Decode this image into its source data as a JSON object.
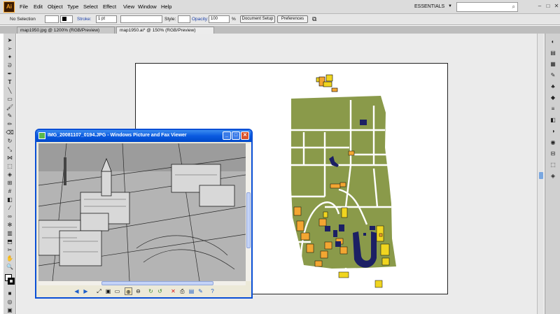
{
  "app": {
    "logo": "Ai"
  },
  "menu": [
    "File",
    "Edit",
    "Object",
    "Type",
    "Select",
    "Effect",
    "View",
    "Window",
    "Help"
  ],
  "workspace": {
    "label": "ESSENTIALS"
  },
  "controlbar": {
    "selection": "No Selection",
    "stroke_label": "Stroke:",
    "stroke_value": "1 pt",
    "style_label": "Style:",
    "opacity_label": "Opacity:",
    "opacity_value": "100",
    "percent": "%",
    "doc_setup": "Document Setup",
    "preferences": "Preferences"
  },
  "tabs": [
    {
      "label": "map1950.jpg @ 1200% (RGB/Preview)"
    },
    {
      "label": "map1950.ai* @ 150% (RGB/Preview)"
    }
  ],
  "viewer": {
    "title": "IMG_20081107_0194.JPG - Windows Picture and Fax Viewer"
  },
  "colors": {
    "map_green": "#8a9a4a",
    "building_orange": "#f3a632",
    "building_yellow": "#f0d520",
    "building_navy": "#1c2064",
    "xp_blue": "#0a5ae0"
  }
}
